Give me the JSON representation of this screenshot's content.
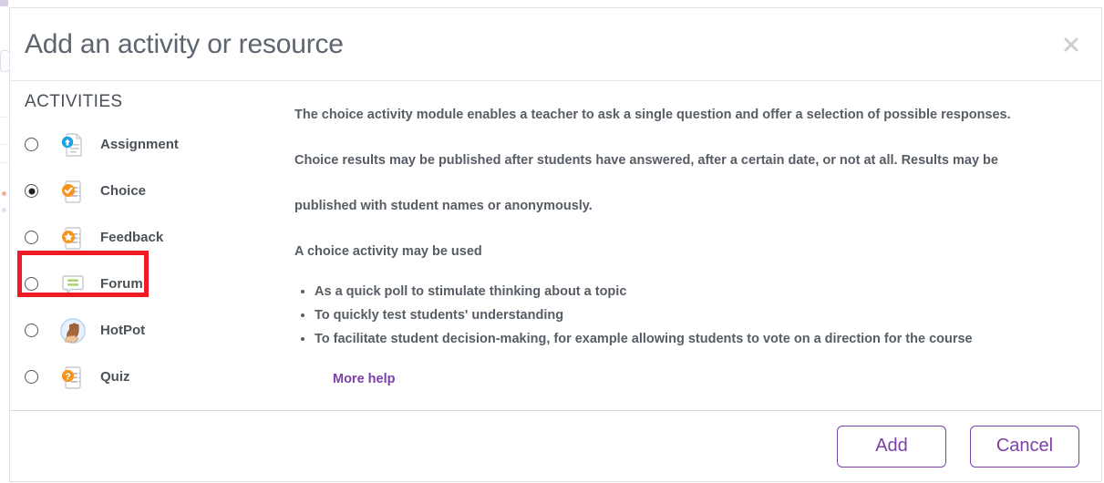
{
  "modal": {
    "title": "Add an activity or resource",
    "close_label": "×",
    "close_icon": "close-icon"
  },
  "sidebar": {
    "section_title": "ACTIVITIES",
    "items": [
      {
        "label": "Assignment",
        "icon": "assignment-doc-upload-icon",
        "selected": false
      },
      {
        "label": "Choice",
        "icon": "choice-doc-check-icon",
        "selected": true
      },
      {
        "label": "Feedback",
        "icon": "feedback-doc-star-icon",
        "selected": false
      },
      {
        "label": "Forum",
        "icon": "forum-speech-bubble-icon",
        "selected": false
      },
      {
        "label": "HotPot",
        "icon": "hotpot-hand-icon",
        "selected": false
      },
      {
        "label": "Quiz",
        "icon": "quiz-doc-question-icon",
        "selected": false
      }
    ]
  },
  "description": {
    "paragraphs": [
      "The choice activity module enables a teacher to ask a single question and offer a selection of possible responses.",
      "Choice results may be published after students have answered, after a certain date, or not at all. Results may be published with student names or anonymously.",
      "A choice activity may be used"
    ],
    "bullets": [
      "As a quick poll to stimulate thinking about a topic",
      "To quickly test students' understanding",
      "To facilitate student decision-making, for example allowing students to vote on a direction for the course"
    ],
    "more_help_label": "More help"
  },
  "footer": {
    "add_label": "Add",
    "cancel_label": "Cancel"
  },
  "colors": {
    "accent_purple": "#7d3fa8",
    "annotation_red": "#ee1b24",
    "icon_orange": "#f7941d",
    "icon_blue": "#29a4e0",
    "icon_green": "#9ccc65",
    "text_gray": "#565d65"
  }
}
